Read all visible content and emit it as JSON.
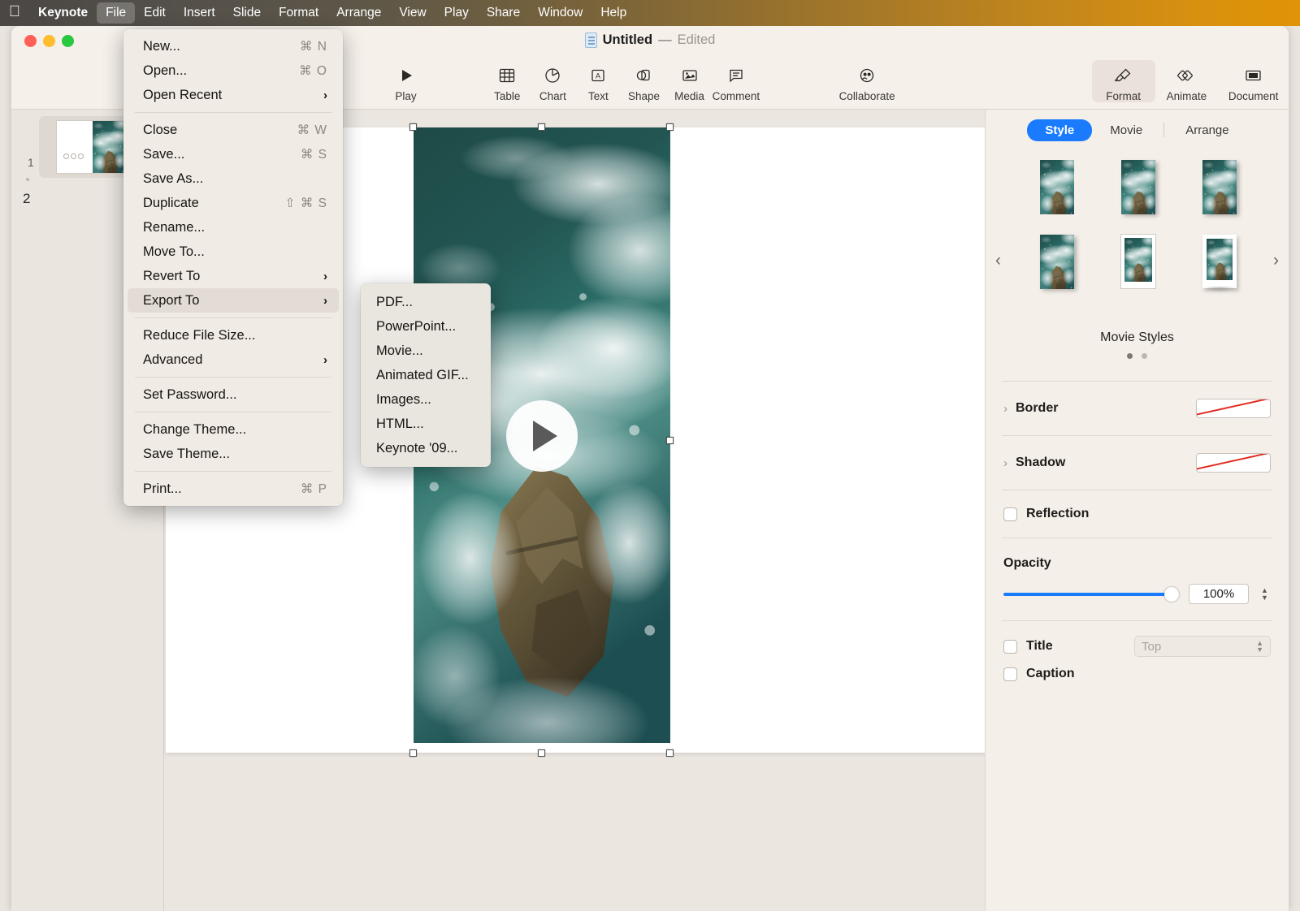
{
  "menubar": {
    "apple_icon": "apple-icon",
    "items": [
      {
        "label": "Keynote",
        "bold": true,
        "active": false
      },
      {
        "label": "File",
        "bold": false,
        "active": true
      },
      {
        "label": "Edit",
        "bold": false,
        "active": false
      },
      {
        "label": "Insert",
        "bold": false,
        "active": false
      },
      {
        "label": "Slide",
        "bold": false,
        "active": false
      },
      {
        "label": "Format",
        "bold": false,
        "active": false
      },
      {
        "label": "Arrange",
        "bold": false,
        "active": false
      },
      {
        "label": "View",
        "bold": false,
        "active": false
      },
      {
        "label": "Play",
        "bold": false,
        "active": false
      },
      {
        "label": "Share",
        "bold": false,
        "active": false
      },
      {
        "label": "Window",
        "bold": false,
        "active": false
      },
      {
        "label": "Help",
        "bold": false,
        "active": false
      }
    ]
  },
  "titlebar": {
    "document_name": "Untitled",
    "dash": "—",
    "edit_state": "Edited"
  },
  "toolbar": {
    "play": "Play",
    "table": "Table",
    "chart": "Chart",
    "text": "Text",
    "shape": "Shape",
    "media": "Media",
    "comment": "Comment",
    "collaborate": "Collaborate",
    "format": "Format",
    "animate": "Animate",
    "document": "Document"
  },
  "file_menu": {
    "items": [
      {
        "label": "New...",
        "shortcut": "⌘ N",
        "type": "item"
      },
      {
        "label": "Open...",
        "shortcut": "⌘ O",
        "type": "item"
      },
      {
        "label": "Open Recent",
        "shortcut": "",
        "type": "submenu"
      },
      {
        "type": "separator"
      },
      {
        "label": "Close",
        "shortcut": "⌘ W",
        "type": "item"
      },
      {
        "label": "Save...",
        "shortcut": "⌘ S",
        "type": "item"
      },
      {
        "label": "Save As...",
        "shortcut": "",
        "type": "item"
      },
      {
        "label": "Duplicate",
        "shortcut": "⇧ ⌘ S",
        "type": "item"
      },
      {
        "label": "Rename...",
        "shortcut": "",
        "type": "item"
      },
      {
        "label": "Move To...",
        "shortcut": "",
        "type": "item"
      },
      {
        "label": "Revert To",
        "shortcut": "",
        "type": "submenu"
      },
      {
        "label": "Export To",
        "shortcut": "",
        "type": "submenu",
        "highlighted": true
      },
      {
        "type": "separator"
      },
      {
        "label": "Reduce File Size...",
        "shortcut": "",
        "type": "item"
      },
      {
        "label": "Advanced",
        "shortcut": "",
        "type": "submenu"
      },
      {
        "type": "separator"
      },
      {
        "label": "Set Password...",
        "shortcut": "",
        "type": "item"
      },
      {
        "type": "separator"
      },
      {
        "label": "Change Theme...",
        "shortcut": "",
        "type": "item"
      },
      {
        "label": "Save Theme...",
        "shortcut": "",
        "type": "item"
      },
      {
        "type": "separator"
      },
      {
        "label": "Print...",
        "shortcut": "⌘ P",
        "type": "item"
      }
    ]
  },
  "export_menu": {
    "items": [
      {
        "label": "PDF..."
      },
      {
        "label": "PowerPoint..."
      },
      {
        "label": "Movie..."
      },
      {
        "label": "Animated GIF..."
      },
      {
        "label": "Images..."
      },
      {
        "label": "HTML..."
      },
      {
        "label": "Keynote '09..."
      }
    ]
  },
  "sidebar": {
    "slides": [
      {
        "number": "1",
        "selected": true
      },
      {
        "number": "2",
        "selected": false
      }
    ]
  },
  "inspector": {
    "tabs": [
      {
        "label": "Style",
        "active": true
      },
      {
        "label": "Movie",
        "active": false
      },
      {
        "label": "Arrange",
        "active": false
      }
    ],
    "styles": {
      "label": "Movie Styles",
      "page_dots": 2,
      "active_dot": 0,
      "prev_arrow": "chevron-left-icon",
      "next_arrow": "chevron-right-icon",
      "thumbnail_count": 6
    },
    "border": {
      "label": "Border",
      "value": "None"
    },
    "shadow": {
      "label": "Shadow",
      "value": "None"
    },
    "reflection": {
      "label": "Reflection",
      "checked": false
    },
    "opacity": {
      "label": "Opacity",
      "value": "100%",
      "percent": 100
    },
    "title": {
      "label": "Title",
      "checked": false,
      "position": "Top"
    },
    "caption": {
      "label": "Caption",
      "checked": false
    }
  },
  "canvas": {
    "object_type": "movie-placeholder",
    "play_overlay": "play-icon"
  },
  "colors": {
    "accent_blue": "#1a7bff",
    "menubar_orange": "#e09306",
    "window_bg": "#f2ece6",
    "inspector_bg": "#f5efe9",
    "swatch_none_line": "#e02b20"
  }
}
